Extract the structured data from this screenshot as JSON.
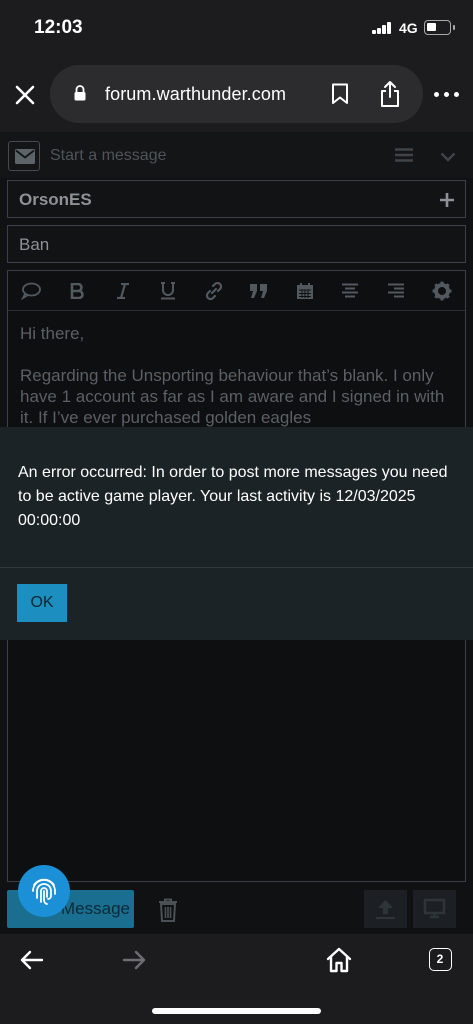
{
  "status_bar": {
    "time": "12:03",
    "network": "4G"
  },
  "browser": {
    "url": "forum.warthunder.com",
    "close_icon": "close-icon",
    "bookmark_icon": "bookmark-icon",
    "share_icon": "share-icon",
    "more_icon": "more-icon"
  },
  "composer": {
    "start_placeholder": "Start a message",
    "recipient": "OrsonES",
    "subject": "Ban",
    "body_lines": [
      "Hi there,",
      "Regarding the Unsporting behaviour that’s blank. I only have 1 account as far as I am aware and I signed in with it. If I’ve ever purchased golden eagles"
    ],
    "send_label": "Message",
    "toolbar_icons": [
      "speech-bubble-icon",
      "bold-icon",
      "italic-icon",
      "underline-icon",
      "link-icon",
      "quote-icon",
      "calendar-icon",
      "align-center-icon",
      "align-right-icon",
      "gear-icon"
    ]
  },
  "dialog": {
    "message": "An error occurred: In order to post more messages you need to be active game player. Your last activity is 12/03/2025 00:00:00",
    "ok_label": "OK"
  },
  "bottom_nav": {
    "tab_count": "2"
  },
  "colors": {
    "accent": "#1c8ec0",
    "dialog_bg": "#1c2327",
    "page_bg": "#0f1113",
    "browser_chrome": "#1c1c1e"
  }
}
